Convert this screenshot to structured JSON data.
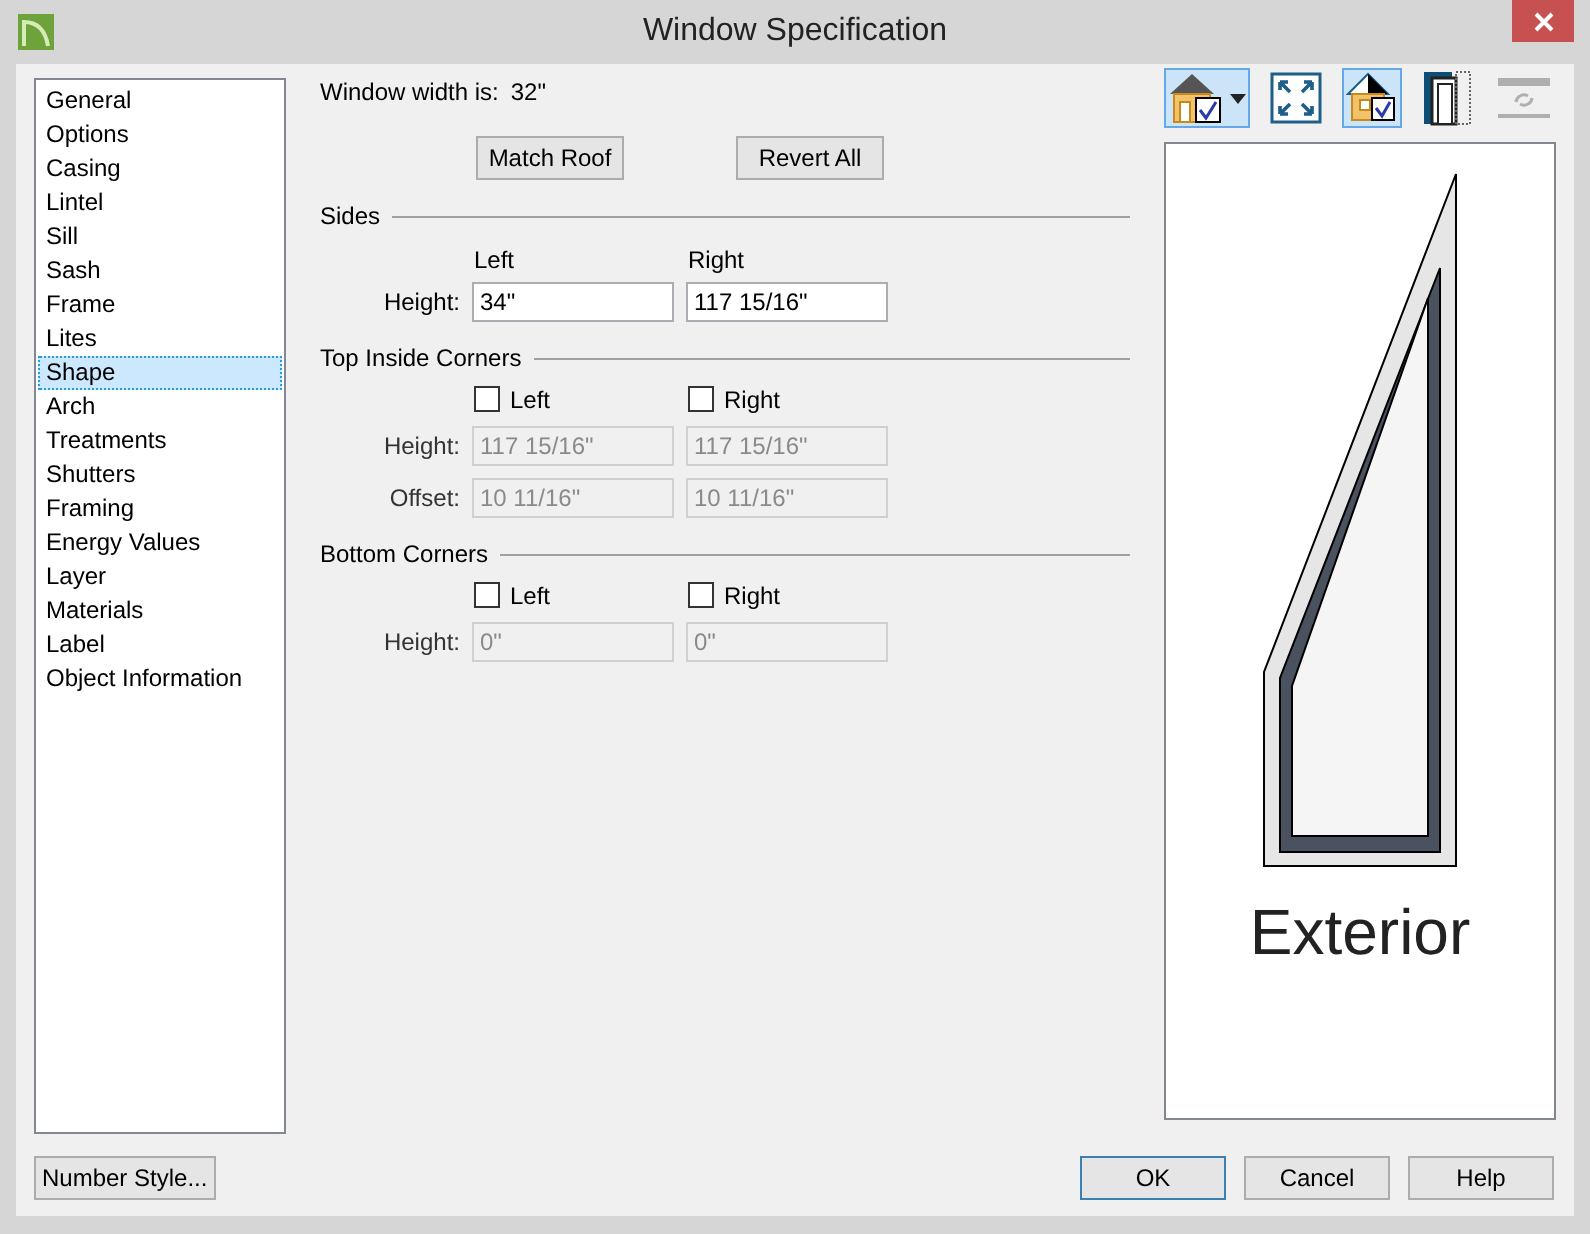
{
  "window": {
    "title": "Window Specification"
  },
  "sidebar": {
    "items": [
      {
        "label": "General",
        "selected": false
      },
      {
        "label": "Options",
        "selected": false
      },
      {
        "label": "Casing",
        "selected": false
      },
      {
        "label": "Lintel",
        "selected": false
      },
      {
        "label": "Sill",
        "selected": false
      },
      {
        "label": "Sash",
        "selected": false
      },
      {
        "label": "Frame",
        "selected": false
      },
      {
        "label": "Lites",
        "selected": false
      },
      {
        "label": "Shape",
        "selected": true
      },
      {
        "label": "Arch",
        "selected": false
      },
      {
        "label": "Treatments",
        "selected": false
      },
      {
        "label": "Shutters",
        "selected": false
      },
      {
        "label": "Framing",
        "selected": false
      },
      {
        "label": "Energy Values",
        "selected": false
      },
      {
        "label": "Layer",
        "selected": false
      },
      {
        "label": "Materials",
        "selected": false
      },
      {
        "label": "Label",
        "selected": false
      },
      {
        "label": "Object Information",
        "selected": false
      }
    ]
  },
  "width": {
    "label": "Window width is:",
    "value": "32\""
  },
  "actions": [
    "Match Roof",
    "Revert All"
  ],
  "sections": [
    {
      "title": "Sides",
      "column_labels": [
        "Left",
        "Right"
      ],
      "rows": [
        {
          "label": "Height:",
          "fields": [
            {
              "value": "34\"",
              "disabled": false
            },
            {
              "value": "117 15/16\"",
              "disabled": false
            }
          ]
        }
      ]
    },
    {
      "title": "Top Inside Corners",
      "checkboxes": [
        {
          "label": "Left",
          "checked": false
        },
        {
          "label": "Right",
          "checked": false
        }
      ],
      "rows": [
        {
          "label": "Height:",
          "fields": [
            {
              "value": "117 15/16\"",
              "disabled": true
            },
            {
              "value": "117 15/16\"",
              "disabled": true
            }
          ]
        },
        {
          "label": "Offset:",
          "fields": [
            {
              "value": "10 11/16\"",
              "disabled": true
            },
            {
              "value": "10 11/16\"",
              "disabled": true
            }
          ]
        }
      ]
    },
    {
      "title": "Bottom Corners",
      "checkboxes": [
        {
          "label": "Left",
          "checked": false
        },
        {
          "label": "Right",
          "checked": false
        }
      ],
      "rows": [
        {
          "label": "Height:",
          "fields": [
            {
              "value": "0\"",
              "disabled": true
            },
            {
              "value": "0\"",
              "disabled": true
            }
          ]
        }
      ]
    }
  ],
  "toolbar": [
    {
      "kind": "view",
      "selected": true,
      "disabled": false
    },
    {
      "kind": "fill",
      "selected": false,
      "disabled": false
    },
    {
      "kind": "show",
      "selected": true,
      "disabled": false
    },
    {
      "kind": "door",
      "selected": false,
      "disabled": false
    },
    {
      "kind": "swap",
      "selected": false,
      "disabled": true
    }
  ],
  "preview": {
    "label": "Exterior"
  },
  "footer": {
    "number_style": "Number Style...",
    "buttons": [
      {
        "label": "OK",
        "default": true
      },
      {
        "label": "Cancel",
        "default": false
      },
      {
        "label": "Help",
        "default": false
      }
    ]
  }
}
